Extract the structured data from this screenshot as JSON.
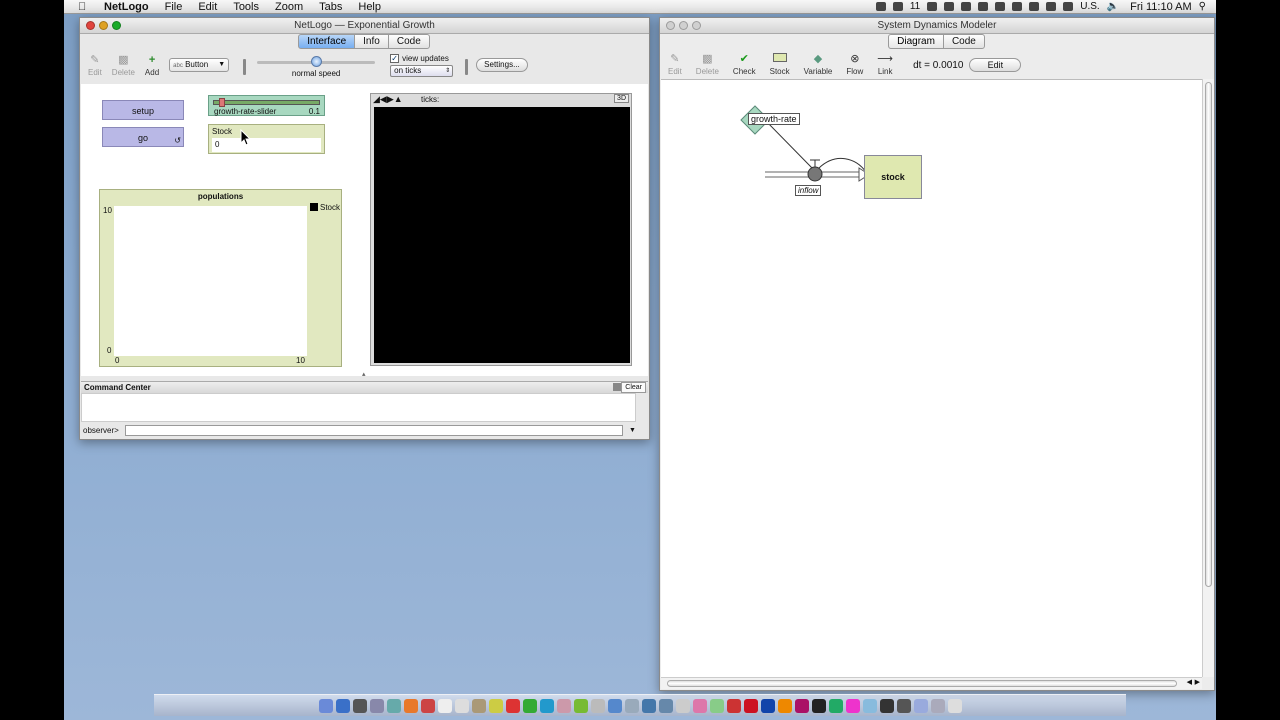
{
  "menubar": {
    "apple": "",
    "app_name": "NetLogo",
    "items": [
      "File",
      "Edit",
      "Tools",
      "Zoom",
      "Tabs",
      "Help"
    ],
    "status_number": "11",
    "input_source": "U.S.",
    "clock": "Fri 11:10 AM"
  },
  "netlogo": {
    "title": "NetLogo — Exponential Growth",
    "tabs": [
      "Interface",
      "Info",
      "Code"
    ],
    "active_tab": "Interface",
    "toolbar": {
      "edit": "Edit",
      "delete": "Delete",
      "add": "Add",
      "widget_type": "Button",
      "widget_type_prefix": "abc",
      "speed_label": "normal speed",
      "view_updates_label": "view updates",
      "view_updates_checked": "✓",
      "update_mode": "on ticks",
      "settings": "Settings..."
    },
    "widgets": {
      "setup_button": "setup",
      "go_button": "go",
      "slider_label": "growth-rate-slider",
      "slider_value": "0.1",
      "monitor_label": "Stock",
      "monitor_value": "0",
      "view_ticks_label": "ticks:",
      "view_3d": "3D",
      "plot": {
        "title": "populations",
        "y_max": "10",
        "y_min": "0",
        "x_min": "0",
        "x_max": "10",
        "legend": "Stock"
      }
    },
    "command_center": {
      "title": "Command Center",
      "clear": "Clear",
      "prompt": "observer>"
    }
  },
  "sdm": {
    "title": "System Dynamics Modeler",
    "tabs": [
      "Diagram",
      "Code"
    ],
    "active_tab": "Diagram",
    "toolbar": {
      "edit": "Edit",
      "delete": "Delete",
      "check": "Check",
      "stock": "Stock",
      "variable": "Variable",
      "flow": "Flow",
      "link": "Link",
      "dt": "dt = 0.0010",
      "edit_button": "Edit"
    },
    "diagram": {
      "variable": "growth-rate",
      "flow": "inflow",
      "stock": "stock"
    }
  },
  "colors": {
    "button": "#b9b8e6",
    "slider": "#a8d8c0",
    "monitor": "#e1e8c0",
    "stock_fill": "#dfe8b0",
    "variable_fill": "#a8d8c0",
    "active_tab": "#78aef0",
    "desktop": "#8aaad0"
  }
}
